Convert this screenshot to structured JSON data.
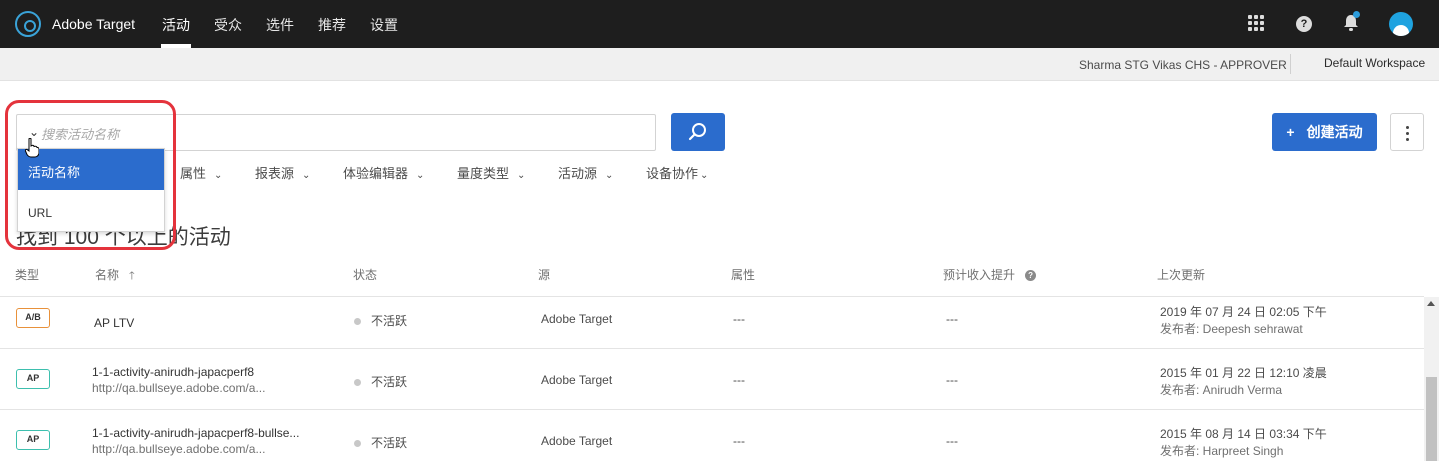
{
  "app": {
    "name": "Adobe Target",
    "nav": [
      "活动",
      "受众",
      "选件",
      "推荐",
      "设置"
    ],
    "active_nav": "活动"
  },
  "subbar": {
    "user_role": "Sharma STG Vikas CHS - APPROVER",
    "workspace": "Default Workspace"
  },
  "search": {
    "placeholder": "搜索活动名称",
    "dropdown_options": [
      "活动名称",
      "URL"
    ],
    "selected_option": "活动名称"
  },
  "toolbar": {
    "create_label": "创建活动",
    "create_plus": "+"
  },
  "filters": [
    "属性",
    "报表源",
    "体验编辑器",
    "量度类型",
    "活动源",
    "设备协作"
  ],
  "result_count": "找到 100 个以上的活动",
  "table": {
    "headers": [
      "类型",
      "名称",
      "状态",
      "源",
      "属性",
      "预计收入提升",
      "上次更新"
    ],
    "rows": [
      {
        "type": "A/B",
        "type_color": "#e8913a",
        "name": "AP LTV",
        "url": "",
        "status": "不活跃",
        "source": "Adobe Target",
        "property": "---",
        "lift": "---",
        "updated": "2019 年 07 月 24 日 02:05 下午",
        "publisher": "发布者: Deepesh sehrawat"
      },
      {
        "type": "AP",
        "type_color": "#3dbfae",
        "name": "1-1-activity-anirudh-japacperf8",
        "url": "http://qa.bullseye.adobe.com/a...",
        "status": "不活跃",
        "source": "Adobe Target",
        "property": "---",
        "lift": "---",
        "updated": "2015 年 01 月 22 日 12:10 凌晨",
        "publisher": "发布者: Anirudh Verma"
      },
      {
        "type": "AP",
        "type_color": "#3dbfae",
        "name": "1-1-activity-anirudh-japacperf8-bullse...",
        "url": "http://qa.bullseye.adobe.com/a...",
        "status": "不活跃",
        "source": "Adobe Target",
        "property": "---",
        "lift": "---",
        "updated": "2015 年 08 月 14 日 03:34 下午",
        "publisher": "发布者: Harpreet Singh"
      }
    ]
  },
  "colors": {
    "topbar": "#1e1e1e",
    "primary": "#2b6ccd",
    "highlight": "#e4333c"
  }
}
